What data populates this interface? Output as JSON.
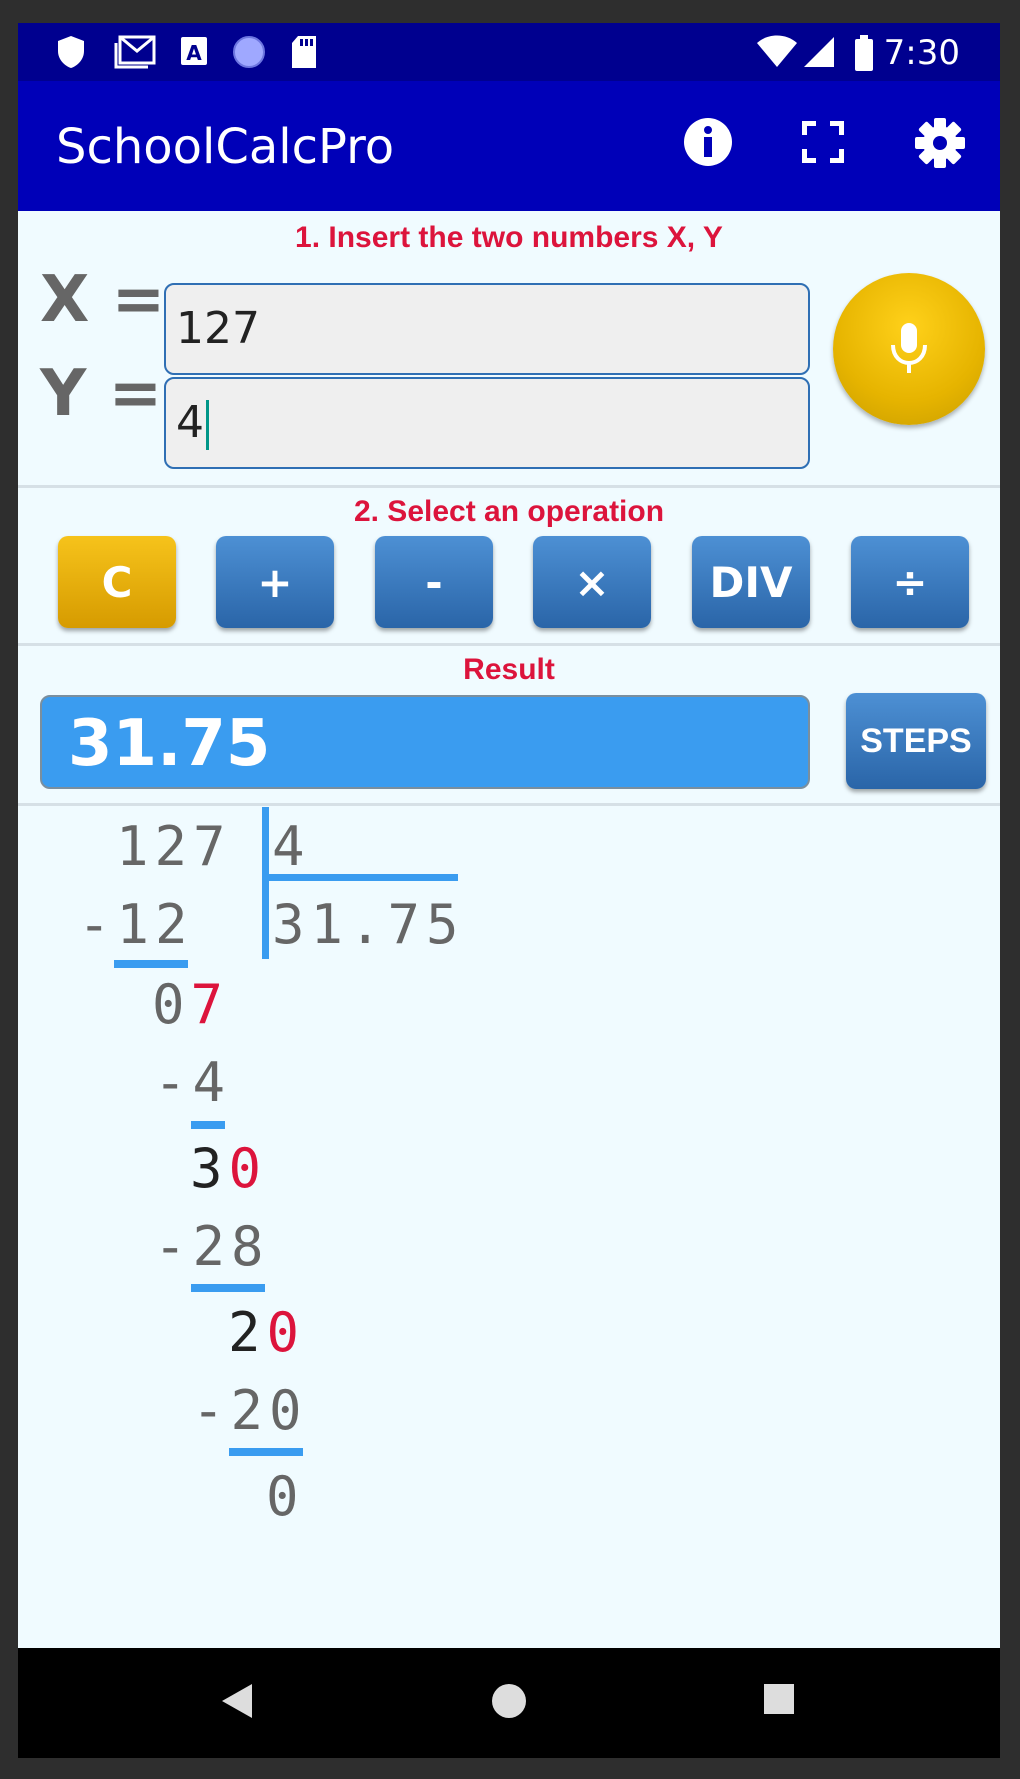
{
  "status_bar": {
    "time": "7:30",
    "icons": [
      "shield-icon",
      "gmail-icon",
      "text-a-icon",
      "circle-icon",
      "sd-card-icon",
      "wifi-icon",
      "signal-icon",
      "battery-icon"
    ]
  },
  "app_bar": {
    "title": "SchoolCalcPro",
    "actions": [
      "info-icon",
      "fullscreen-icon",
      "gear-icon"
    ]
  },
  "inputs": {
    "section_label": "1. Insert the two numbers X, Y",
    "x_label": "X =",
    "x_value": "127",
    "y_label": "Y =",
    "y_value": "4"
  },
  "operations": {
    "section_label": "2. Select an operation",
    "buttons": [
      "C",
      "+",
      "-",
      "×",
      "DIV",
      "÷"
    ]
  },
  "result": {
    "section_label": "Result",
    "value": "31.75",
    "steps_label": "STEPS"
  },
  "long_division": {
    "dividend": "127",
    "divisor": "4",
    "quotient": "31.75",
    "steps": [
      {
        "sub": "-12"
      },
      {
        "remainder_kept": "0",
        "remainder_brought": "7",
        "sub": "-4"
      },
      {
        "remainder_kept": "3",
        "remainder_brought": "0",
        "sub": "-28"
      },
      {
        "remainder_kept": "2",
        "remainder_brought": "0",
        "sub": "-20"
      },
      {
        "final": "0"
      }
    ]
  },
  "colors": {
    "status_bar": "#00008f",
    "app_bar": "#0000b8",
    "accent_red": "#dc143c",
    "button_blue": "#2a65a8",
    "button_gold": "#d69b00",
    "result_blue": "#3a9cf0"
  }
}
